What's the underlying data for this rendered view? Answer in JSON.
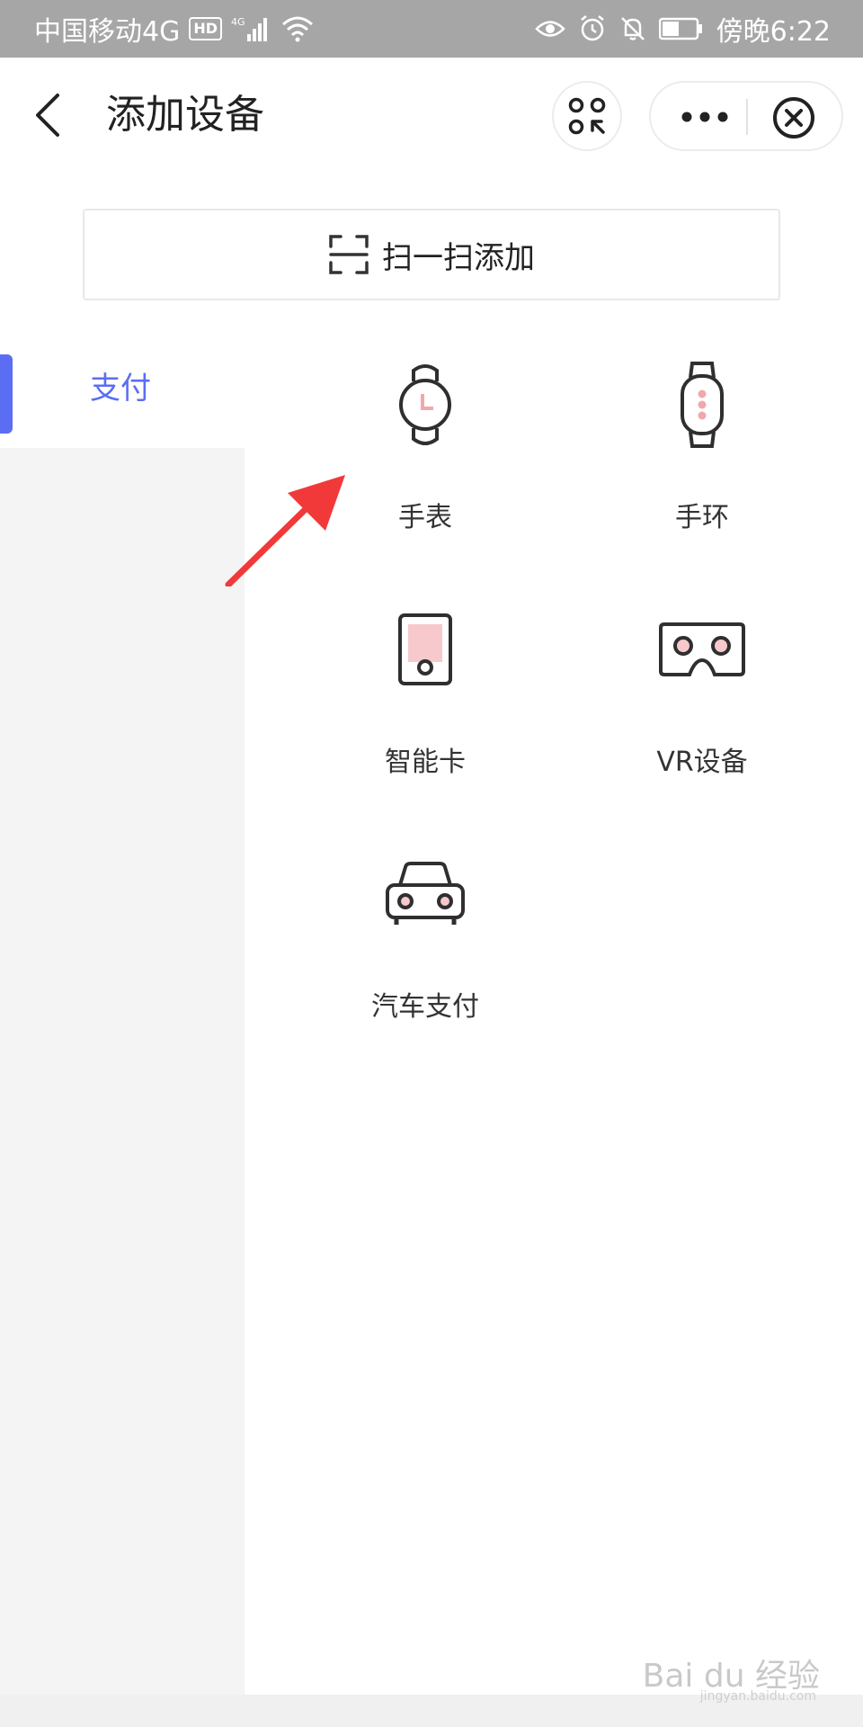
{
  "status_bar": {
    "carrier": "中国移动4G",
    "hd": "HD",
    "network": "4G",
    "time": "傍晚6:22"
  },
  "header": {
    "title": "添加设备"
  },
  "scan_add": {
    "label": "扫一扫添加"
  },
  "categories": [
    {
      "label": "支付",
      "active": true
    }
  ],
  "devices": [
    {
      "label": "手表",
      "icon": "watch-icon"
    },
    {
      "label": "手环",
      "icon": "band-icon"
    },
    {
      "label": "智能卡",
      "icon": "smart-card-icon"
    },
    {
      "label": "VR设备",
      "icon": "vr-headset-icon"
    },
    {
      "label": "汽车支付",
      "icon": "car-icon"
    }
  ],
  "watermark": {
    "text": "Bai du 经验",
    "sub": "jingyan.baidu.com"
  },
  "colors": {
    "accent": "#5b6ef3",
    "icon_stroke": "#2f2f2f",
    "icon_pink": "#f7c9cc",
    "arrow": "#f2393a"
  }
}
